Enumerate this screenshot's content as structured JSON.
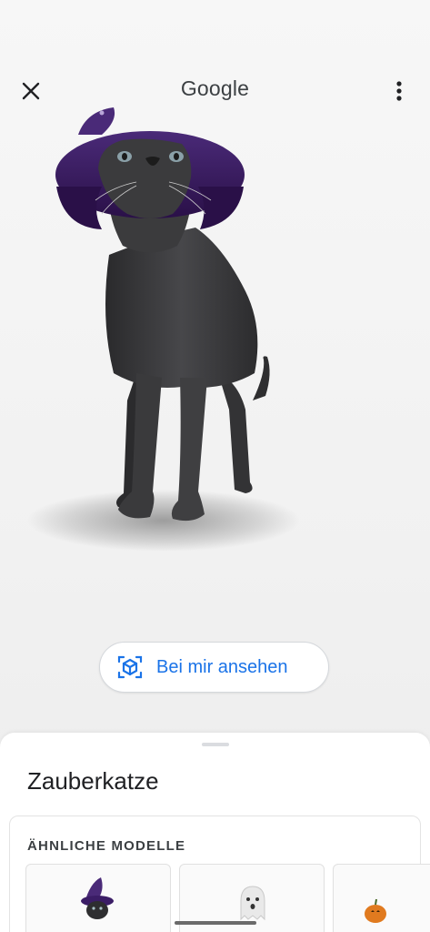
{
  "header": {
    "title": "Google",
    "close_icon": "close-icon",
    "menu_icon": "more-vert-icon"
  },
  "viewer": {
    "model_description_icon": "3d-cat-model"
  },
  "ar_button": {
    "label": "Bei mir ansehen",
    "icon": "view-in-ar-icon",
    "color": "#1a73e8"
  },
  "sheet": {
    "model_name": "Zauberkatze",
    "similar_heading": "ÄHNLICHE MODELLE",
    "similar_models": [
      {
        "icon": "witch-cat-thumb"
      },
      {
        "icon": "ghost-thumb"
      },
      {
        "icon": "pumpkin-thumb"
      }
    ]
  }
}
